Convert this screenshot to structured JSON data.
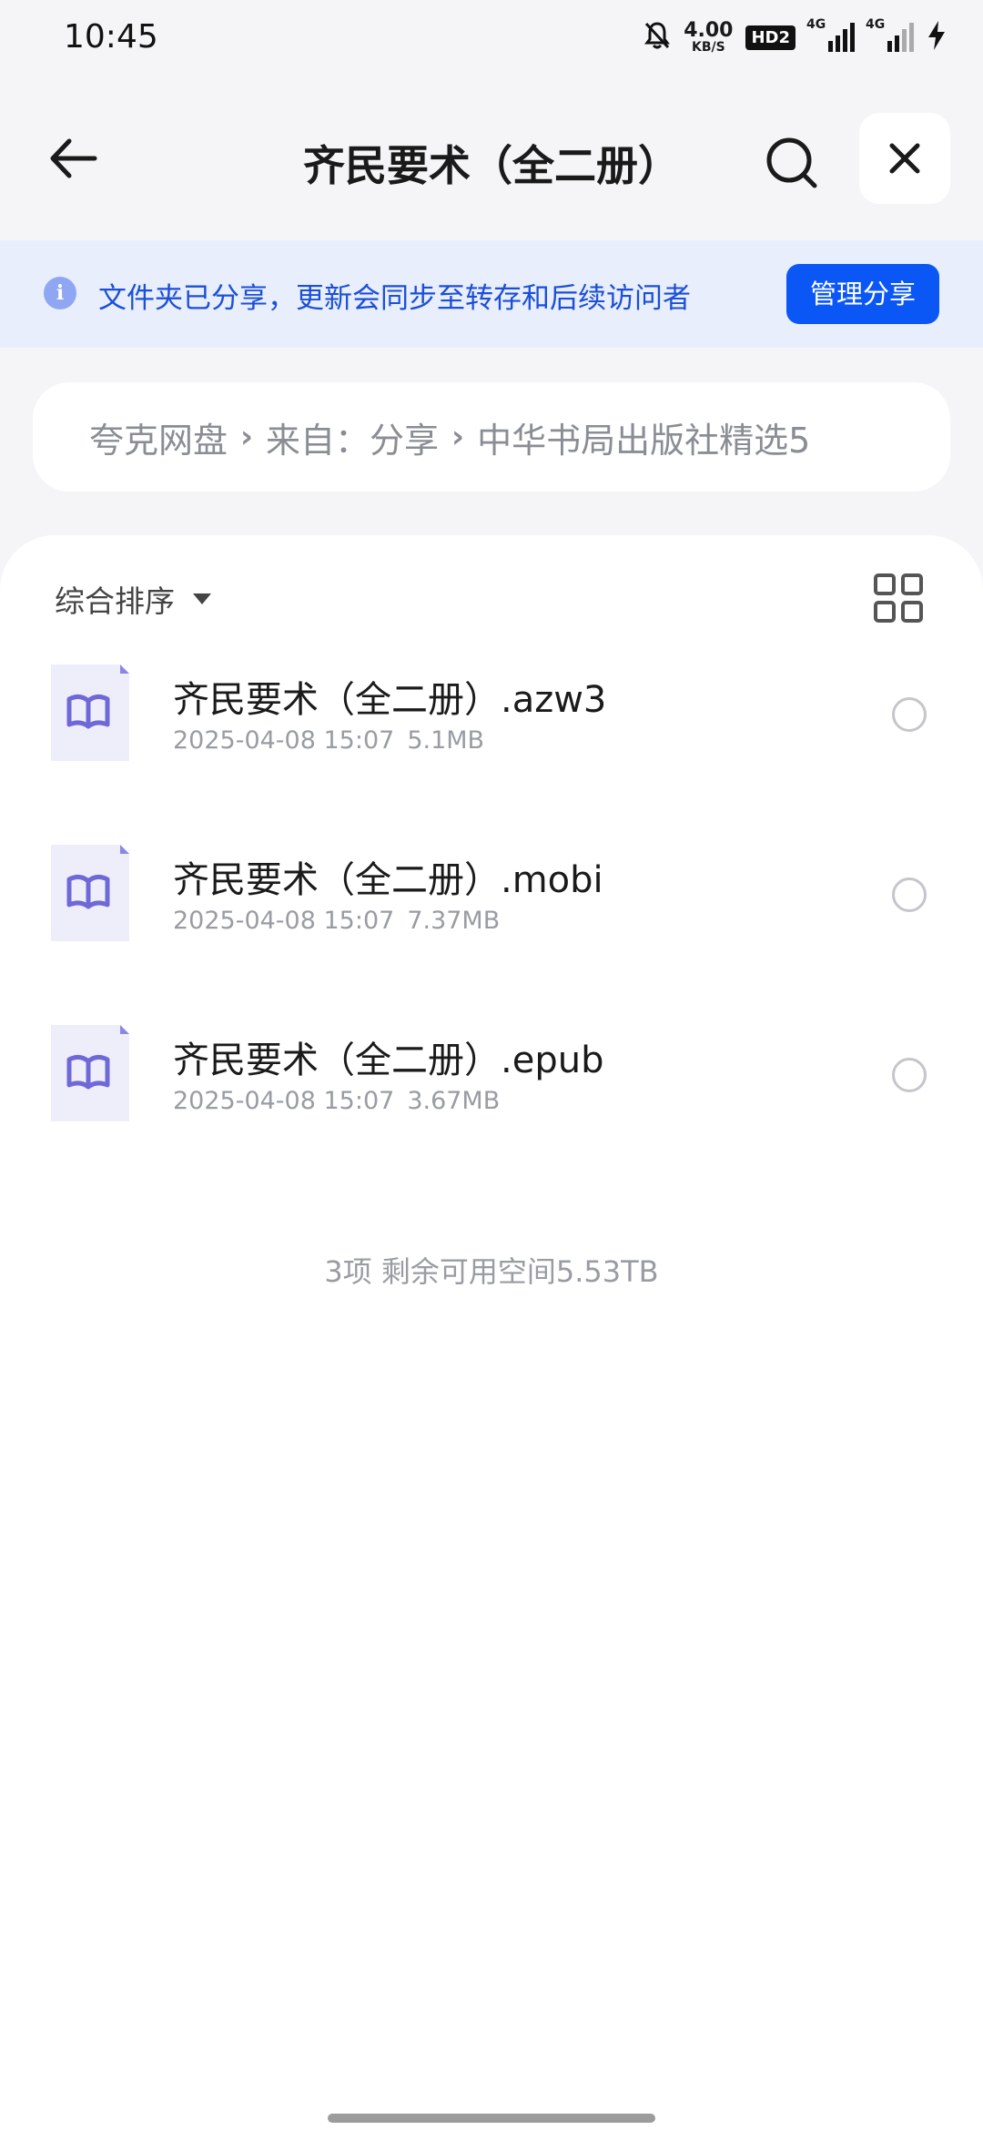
{
  "status_bar": {
    "time": "10:45",
    "net_speed_value": "4.00",
    "net_speed_unit": "KB/S",
    "hd_label": "HD2",
    "sim1_label": "4G",
    "sim2_label": "4G",
    "icons": [
      "mute-bell-icon",
      "hd-voice-icon",
      "signal-icon",
      "signal-icon",
      "charging-icon"
    ]
  },
  "header": {
    "title": "齐民要术（全二册）",
    "icons": {
      "back": "arrow-left-icon",
      "search": "search-icon",
      "close": "close-icon"
    }
  },
  "banner": {
    "message": "文件夹已分享，更新会同步至转存和后续访问者",
    "button_label": "管理分享",
    "colors": {
      "background": "#e8eefb",
      "text": "#1b4fd8",
      "button": "#0b57f6"
    }
  },
  "breadcrumb": {
    "items": [
      "夸克网盘",
      "来自：分享",
      "中华书局出版社精选5"
    ],
    "separator": "›"
  },
  "toolbar": {
    "sort_label": "综合排序",
    "view_toggle_icon": "grid-view-icon"
  },
  "files": [
    {
      "name": "齐民要术（全二册）.azw3",
      "date": "2025-04-08 15:07",
      "size": "5.1MB",
      "icon": "ebook-icon"
    },
    {
      "name": "齐民要术（全二册）.mobi",
      "date": "2025-04-08 15:07",
      "size": "7.37MB",
      "icon": "ebook-icon"
    },
    {
      "name": "齐民要术（全二册）.epub",
      "date": "2025-04-08 15:07",
      "size": "3.67MB",
      "icon": "ebook-icon"
    }
  ],
  "summary": "3项 剩余可用空间5.53TB"
}
